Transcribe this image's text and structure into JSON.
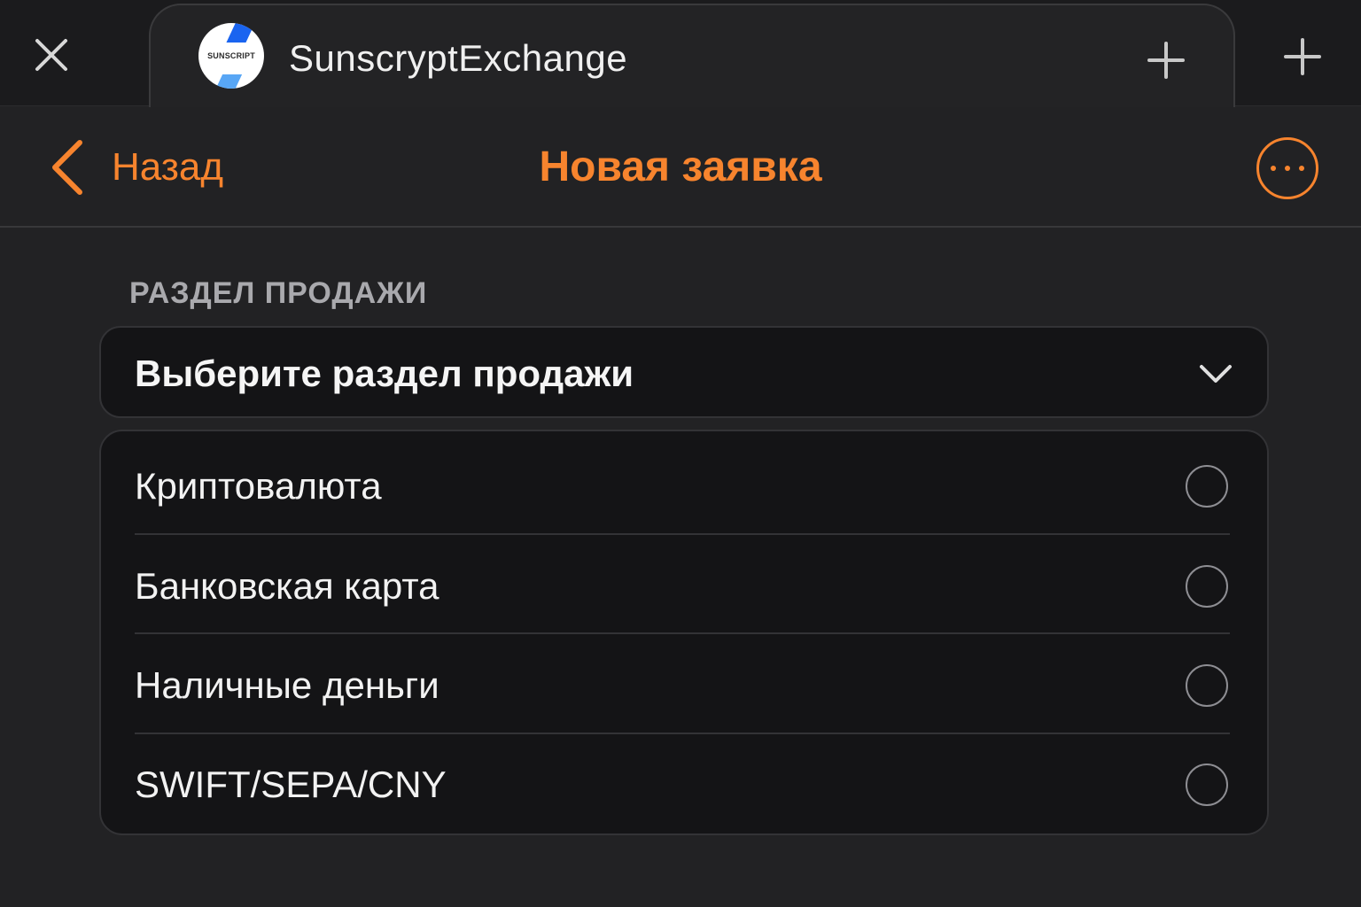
{
  "tabbar": {
    "favicon_text": "SUNSCRIPT",
    "tab_title": "SunscryptExchange",
    "close_icon": "close-icon",
    "plus_icon": "plus-icon"
  },
  "header": {
    "back_label": "Назад",
    "title": "Новая заявка",
    "more_icon": "ellipsis-circle-icon"
  },
  "form": {
    "section_label": "РАЗДЕЛ ПРОДАЖИ",
    "select_placeholder": "Выберите раздел продажи",
    "options": [
      {
        "label": "Криптовалюта",
        "selected": false
      },
      {
        "label": "Банковская карта",
        "selected": false
      },
      {
        "label": "Наличные деньги",
        "selected": false
      },
      {
        "label": "SWIFT/SEPA/CNY",
        "selected": false
      }
    ]
  },
  "colors": {
    "accent": "#f7842e",
    "background": "#222224",
    "card": "#141416"
  }
}
